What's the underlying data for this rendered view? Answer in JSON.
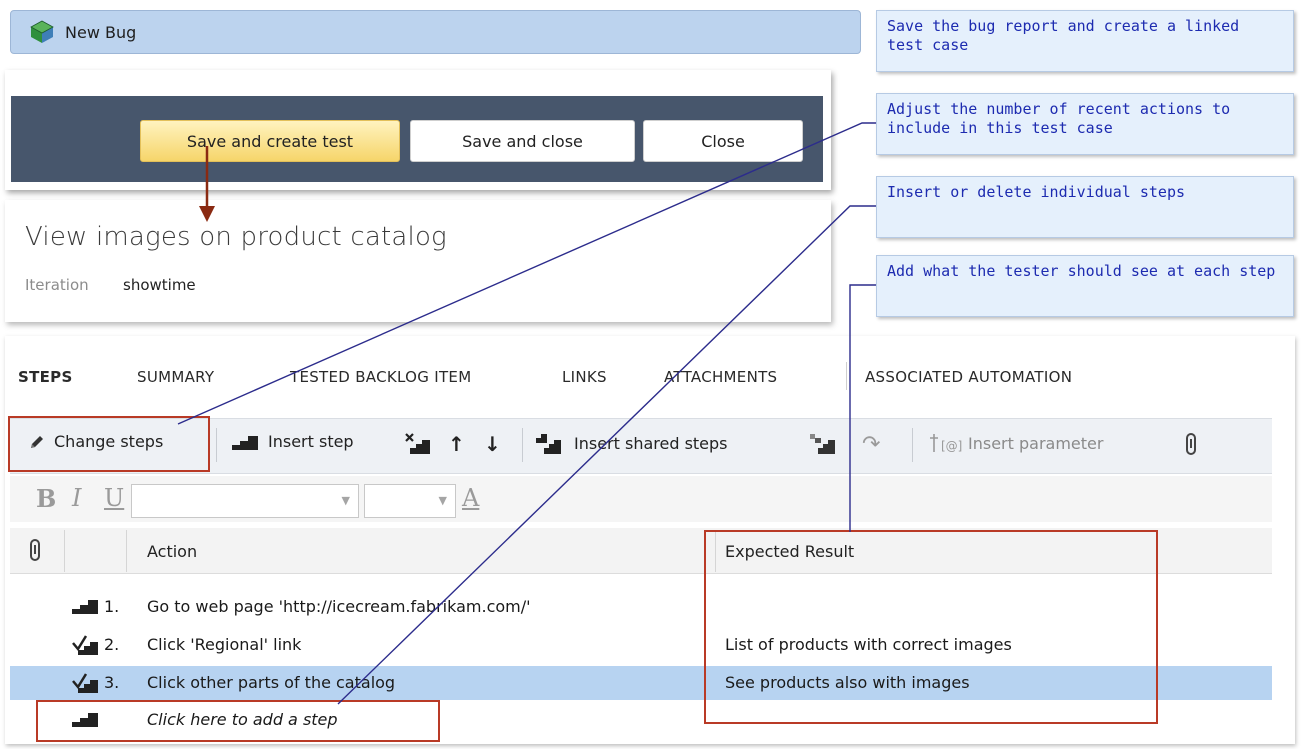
{
  "window": {
    "title": "New Bug",
    "icon": "bug-app-icon"
  },
  "buttons": {
    "save_create_test": "Save and create test",
    "save_close": "Save and close",
    "close": "Close"
  },
  "workitem": {
    "title": "View images on product catalog",
    "iteration_label": "Iteration",
    "iteration_value": "showtime"
  },
  "tabs": [
    {
      "label": "STEPS",
      "active": true
    },
    {
      "label": "SUMMARY",
      "active": false
    },
    {
      "label": "TESTED BACKLOG ITEM",
      "active": false
    },
    {
      "label": "LINKS",
      "active": false
    },
    {
      "label": "ATTACHMENTS",
      "active": false
    },
    {
      "label": "ASSOCIATED AUTOMATION",
      "active": false
    }
  ],
  "toolbar": {
    "change_steps": "Change steps",
    "insert_step": "Insert step",
    "insert_shared_steps": "Insert shared steps",
    "insert_parameter": "Insert parameter"
  },
  "format": {
    "bold": "B",
    "italic": "I",
    "underline": "U",
    "font_color": "A"
  },
  "grid": {
    "col_action": "Action",
    "col_expected": "Expected Result",
    "rows": [
      {
        "num": "1.",
        "action": "Go to web page 'http://icecream.fabrikam.com/'",
        "expected": "",
        "type": "action"
      },
      {
        "num": "2.",
        "action": "Click 'Regional' link",
        "expected": "List of products with correct images",
        "type": "validate"
      },
      {
        "num": "3.",
        "action": "Click other parts of the catalog",
        "expected": "See products also with images",
        "type": "validate",
        "selected": true
      }
    ],
    "add_step": "Click here to add a step"
  },
  "callouts": [
    "Save the bug report and create a linked test case",
    "Adjust the number of recent actions to include in this test case",
    "Insert or delete individual steps",
    "Add what the tester should see at each step"
  ],
  "colors": {
    "title_bar": "#bcd3ee",
    "dark_toolbar": "#47566c",
    "primary_button": "#f6d56a",
    "selected_row": "#b7d3f1",
    "highlight": "#b93a26",
    "callout_text": "#1d2bb0",
    "callout_bg": "#e5f0fc",
    "connector_line": "#2c2c8c"
  }
}
